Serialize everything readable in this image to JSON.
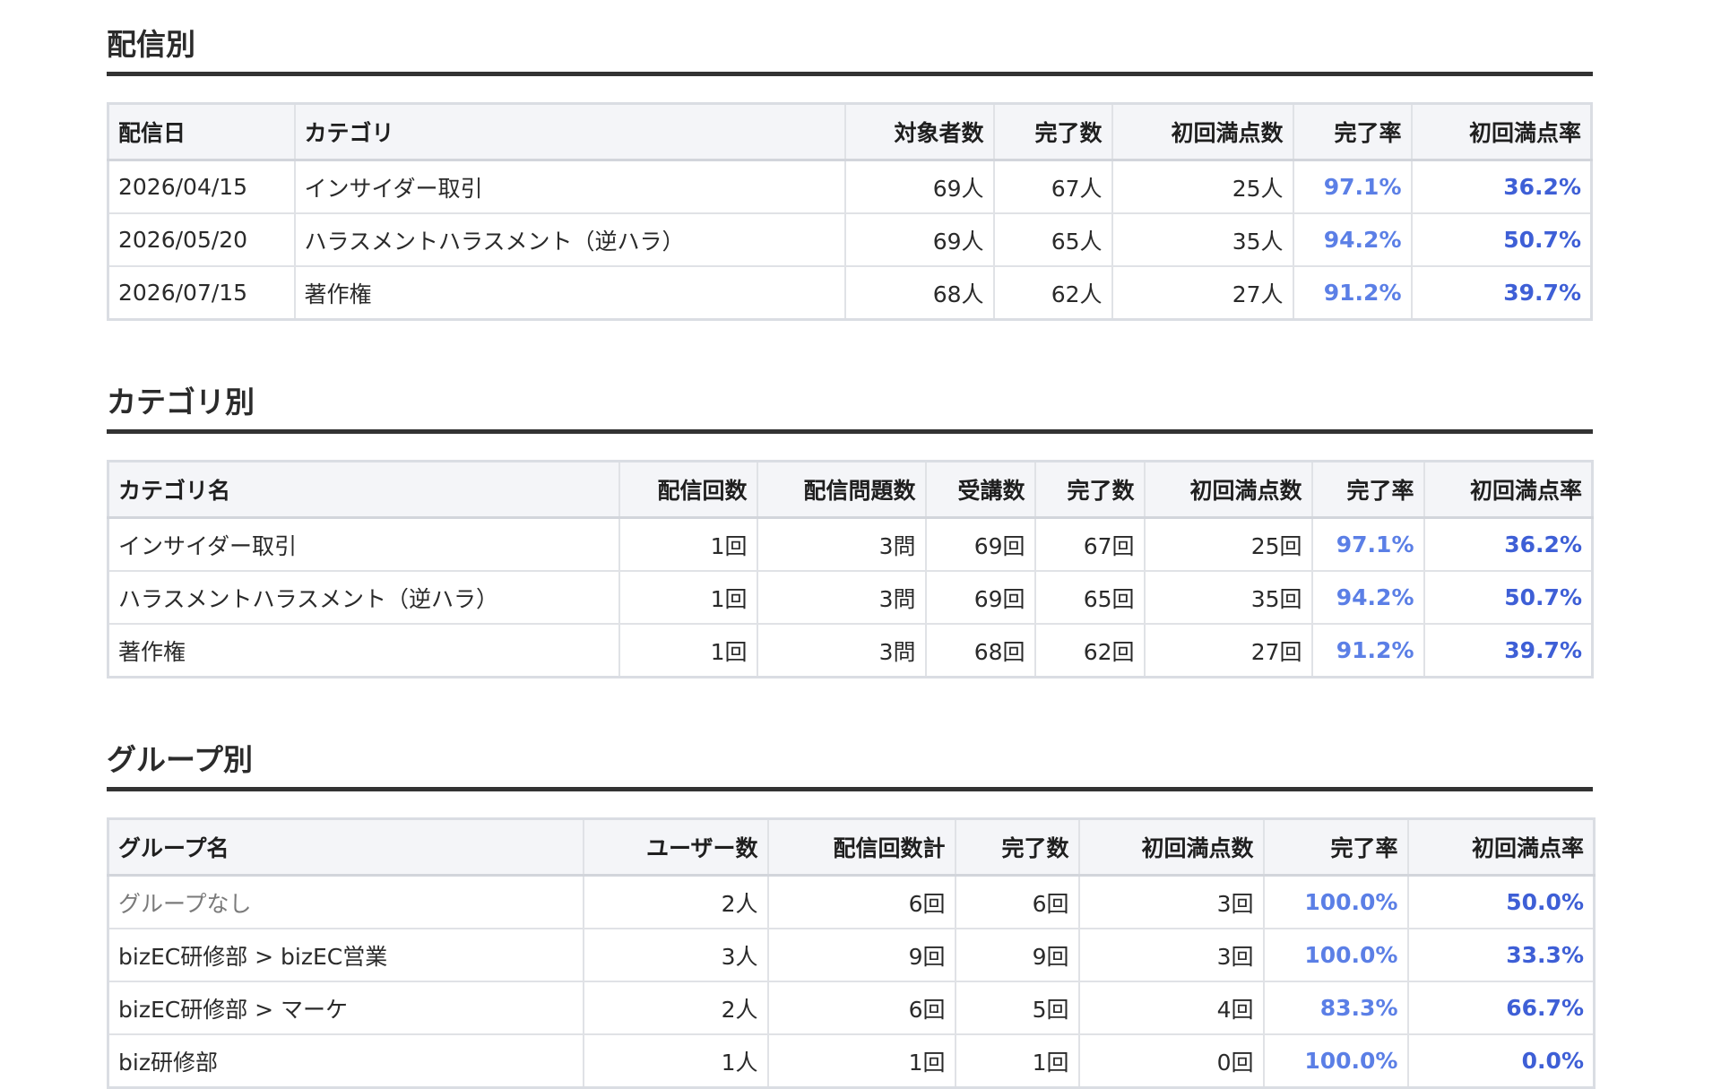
{
  "sections": {
    "by_delivery": {
      "title": "配信別",
      "headers": [
        "配信日",
        "カテゴリ",
        "対象者数",
        "完了数",
        "初回満点数",
        "完了率",
        "初回満点率"
      ],
      "rows": [
        [
          "2026/04/15",
          "インサイダー取引",
          "69人",
          "67人",
          "25人",
          "97.1%",
          "36.2%"
        ],
        [
          "2026/05/20",
          "ハラスメントハラスメント（逆ハラ）",
          "69人",
          "65人",
          "35人",
          "94.2%",
          "50.7%"
        ],
        [
          "2026/07/15",
          "著作権",
          "68人",
          "62人",
          "27人",
          "91.2%",
          "39.7%"
        ]
      ]
    },
    "by_category": {
      "title": "カテゴリ別",
      "headers": [
        "カテゴリ名",
        "配信回数",
        "配信問題数",
        "受講数",
        "完了数",
        "初回満点数",
        "完了率",
        "初回満点率"
      ],
      "rows": [
        [
          "インサイダー取引",
          "1回",
          "3問",
          "69回",
          "67回",
          "25回",
          "97.1%",
          "36.2%"
        ],
        [
          "ハラスメントハラスメント（逆ハラ）",
          "1回",
          "3問",
          "69回",
          "65回",
          "35回",
          "94.2%",
          "50.7%"
        ],
        [
          "著作権",
          "1回",
          "3問",
          "68回",
          "62回",
          "27回",
          "91.2%",
          "39.7%"
        ]
      ]
    },
    "by_group": {
      "title": "グループ別",
      "headers": [
        "グループ名",
        "ユーザー数",
        "配信回数計",
        "完了数",
        "初回満点数",
        "完了率",
        "初回満点率"
      ],
      "rows": [
        [
          "グループなし",
          "2人",
          "6回",
          "6回",
          "3回",
          "100.0%",
          "50.0%"
        ],
        [
          "bizEC研修部 > bizEC営業",
          "3人",
          "9回",
          "9回",
          "3回",
          "100.0%",
          "33.3%"
        ],
        [
          "bizEC研修部 > マーケ",
          "2人",
          "6回",
          "5回",
          "4回",
          "83.3%",
          "66.7%"
        ],
        [
          "biz研修部",
          "1人",
          "1回",
          "1回",
          "0回",
          "100.0%",
          "0.0%"
        ]
      ]
    }
  },
  "colors": {
    "completion_rate": "#5b7fe6",
    "first_perfect_rate": "#3e5fd6",
    "muted_text": "#7a7a7a"
  }
}
